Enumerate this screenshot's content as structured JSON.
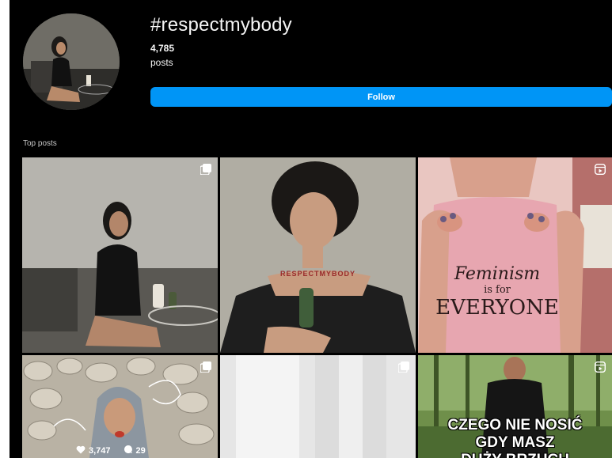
{
  "hashtag": {
    "title": "#respectmybody",
    "post_count": "4,785",
    "post_count_label": "posts",
    "follow_label": "Follow"
  },
  "section": {
    "title": "Top posts"
  },
  "posts": [
    {
      "badge": "carousel-icon"
    },
    {
      "printed_text": "RESPECTMYBODY"
    },
    {
      "badge": "reel-icon",
      "shirt_line1": "Feminism",
      "shirt_line2": "is for",
      "shirt_line3": "EVERYONE"
    },
    {
      "badge": "carousel-icon",
      "likes": "3,747",
      "comments": "29"
    },
    {
      "badge": "carousel-icon"
    },
    {
      "badge": "reel-icon",
      "overlay_line1": "CZEGO NIE NOSIĆ",
      "overlay_line2": "GDY MASZ",
      "overlay_line3": "DUŻY BRZUCH"
    }
  ],
  "colors": {
    "accent": "#0095f6",
    "background": "#000000",
    "text": "#f5f5f5"
  }
}
